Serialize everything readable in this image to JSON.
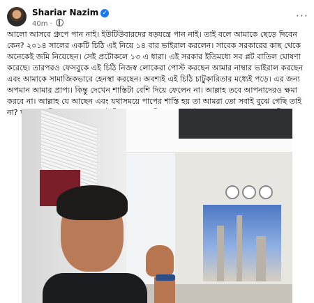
{
  "post": {
    "author": "Shariar Nazim",
    "time": "40m",
    "dot": "·",
    "verified_icon": "verified-badge-icon",
    "visibility_icon": "globe-icon",
    "more_label": "···",
    "text": "আলো আসবে গ্রুপে পান নাই। ইউটিউবারদের ষড়যন্ত্রে পান নাই। তাই বলে আমাকে ছেড়ে দিবেন কেন? ২০১৪ সালের একটি চিঠি এই নিয়ে ১৪ বার ভাইরাল করলেন। সাবেক সরকারের কাছ থেকে অনেকেই জমি নিয়েছেন। সেই প্রটোকলে ১৩ এ ধারা। এই সরকার ইতিমধ্যে সব প্লট বাতিল ঘোষণা করেছে। তারপরও ফেসবুকে এই চিঠি নিজস্ব লোকেরা পোস্ট করছেন আমার নাম্বার ভাইরাল করছেন এবং আমাকে সামাজিকভাবে হেনস্থা করছেন। অবশ্যই এই চিঠি চাটুকারিতার মধ্যেই পড়ে। এর জন্য অপমান আমার প্রাপ্য। কিন্তু দেখেন শাস্তিটা বেশি দিয়ে ফেলেন না। আল্লাহ তবে আপনাদেরও ক্ষমা করবে না। আল্লাহ যে আছেন এবং যথাসময়ে পাপের শাস্তি হয় তা আমরা তো সবাই বুঝে গেছি তাই না? ঘৃণা না ছড়িয়ে শান্ত হন। সবাই মিলে ভাল থাকি। চলুন সবাই যার যার ভুল সংশোধন করি।"
  },
  "colors": {
    "accent": "#1877f2",
    "meta": "#65676b",
    "text": "#050505"
  }
}
